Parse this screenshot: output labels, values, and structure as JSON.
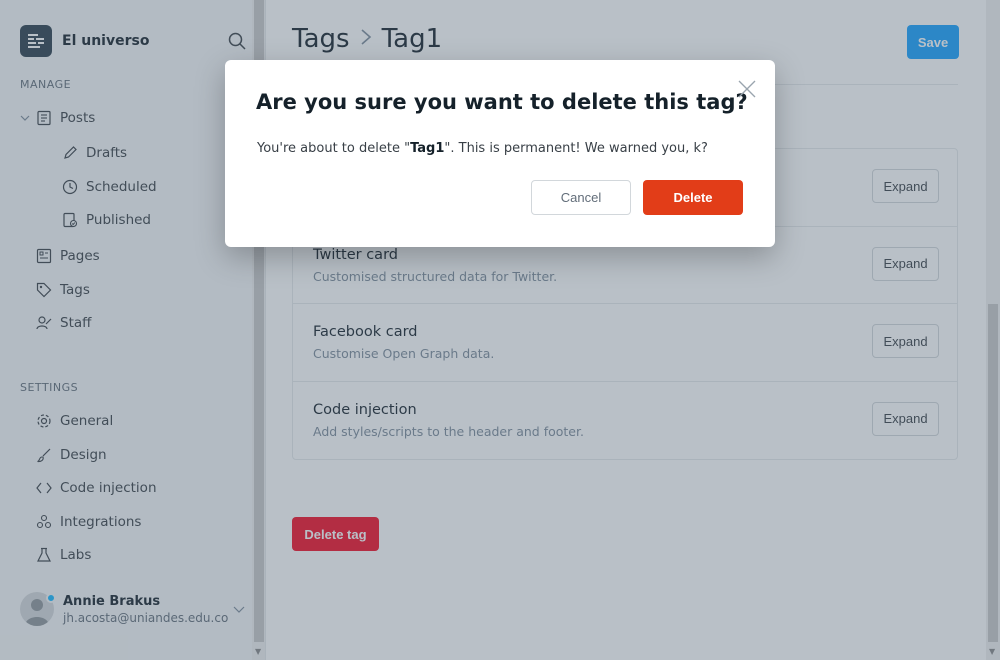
{
  "sidebar": {
    "site_name": "El universo",
    "manage_label": "MANAGE",
    "settings_label": "SETTINGS",
    "manage_items": [
      {
        "label": "Posts",
        "icon": "posts-icon"
      },
      {
        "label": "Drafts",
        "icon": "pencil-icon"
      },
      {
        "label": "Scheduled",
        "icon": "clock-icon"
      },
      {
        "label": "Published",
        "icon": "published-icon"
      },
      {
        "label": "Pages",
        "icon": "pages-icon"
      },
      {
        "label": "Tags",
        "icon": "tag-icon"
      },
      {
        "label": "Staff",
        "icon": "staff-icon"
      }
    ],
    "settings_items": [
      {
        "label": "General",
        "icon": "gear-icon"
      },
      {
        "label": "Design",
        "icon": "brush-icon"
      },
      {
        "label": "Code injection",
        "icon": "code-icon"
      },
      {
        "label": "Integrations",
        "icon": "integrations-icon"
      },
      {
        "label": "Labs",
        "icon": "flask-icon"
      }
    ],
    "user": {
      "name": "Annie Brakus",
      "email": "jh.acosta@uniandes.edu.co"
    }
  },
  "main": {
    "breadcrumb_parent": "Tags",
    "breadcrumb_current": "Tag1",
    "save_label": "Save",
    "cards": [
      {
        "title": "",
        "description": "",
        "button": "Expand"
      },
      {
        "title": "Twitter card",
        "description": "Customised structured data for Twitter.",
        "button": "Expand"
      },
      {
        "title": "Facebook card",
        "description": "Customise Open Graph data.",
        "button": "Expand"
      },
      {
        "title": "Code injection",
        "description": "Add styles/scripts to the header and footer.",
        "button": "Expand"
      }
    ],
    "delete_tag_label": "Delete tag"
  },
  "modal": {
    "title": "Are you sure you want to delete this tag?",
    "body_prefix": "You're about to delete \"",
    "body_tag": "Tag1",
    "body_suffix": "\". This is permanent! We warned you, k?",
    "cancel_label": "Cancel",
    "delete_label": "Delete"
  },
  "colors": {
    "accent": "#14a0ff",
    "danger": "#e23d18",
    "overlay": "#516272"
  }
}
